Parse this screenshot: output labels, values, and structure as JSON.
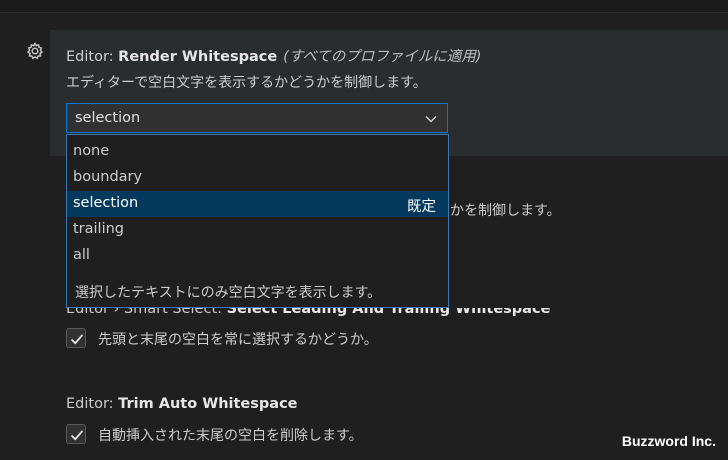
{
  "render_whitespace": {
    "category": "Editor: ",
    "key": "Render Whitespace",
    "scope": "(すべてのプロファイルに適用)",
    "description": "エディターで空白文字を表示するかどうかを制御します。",
    "selected_value": "selection",
    "options": [
      {
        "label": "none"
      },
      {
        "label": "boundary"
      },
      {
        "label": "selection",
        "default_label": "既定"
      },
      {
        "label": "trailing"
      },
      {
        "label": "all"
      }
    ],
    "option_description": "選択したテキストにのみ空白文字を表示します。"
  },
  "hidden_setting_partial_text": "かを制御します。",
  "smart_select": {
    "title_prefix": "Editor › Smart Select: ",
    "title_key": "Select Leading And Trailing Whitespace",
    "checkbox_label": "先頭と末尾の空白を常に選択するかどうか。",
    "checked": true
  },
  "trim_auto_whitespace": {
    "category": "Editor: ",
    "key": "Trim Auto Whitespace",
    "checkbox_label": "自動挿入された末尾の空白を削除します。",
    "checked": true
  },
  "watermark": "Buzzword Inc.",
  "colors": {
    "background": "#1f1f1f",
    "focused_row": "#2a2d2e",
    "accent_border": "#0078d4",
    "selected_option": "#04395e"
  }
}
